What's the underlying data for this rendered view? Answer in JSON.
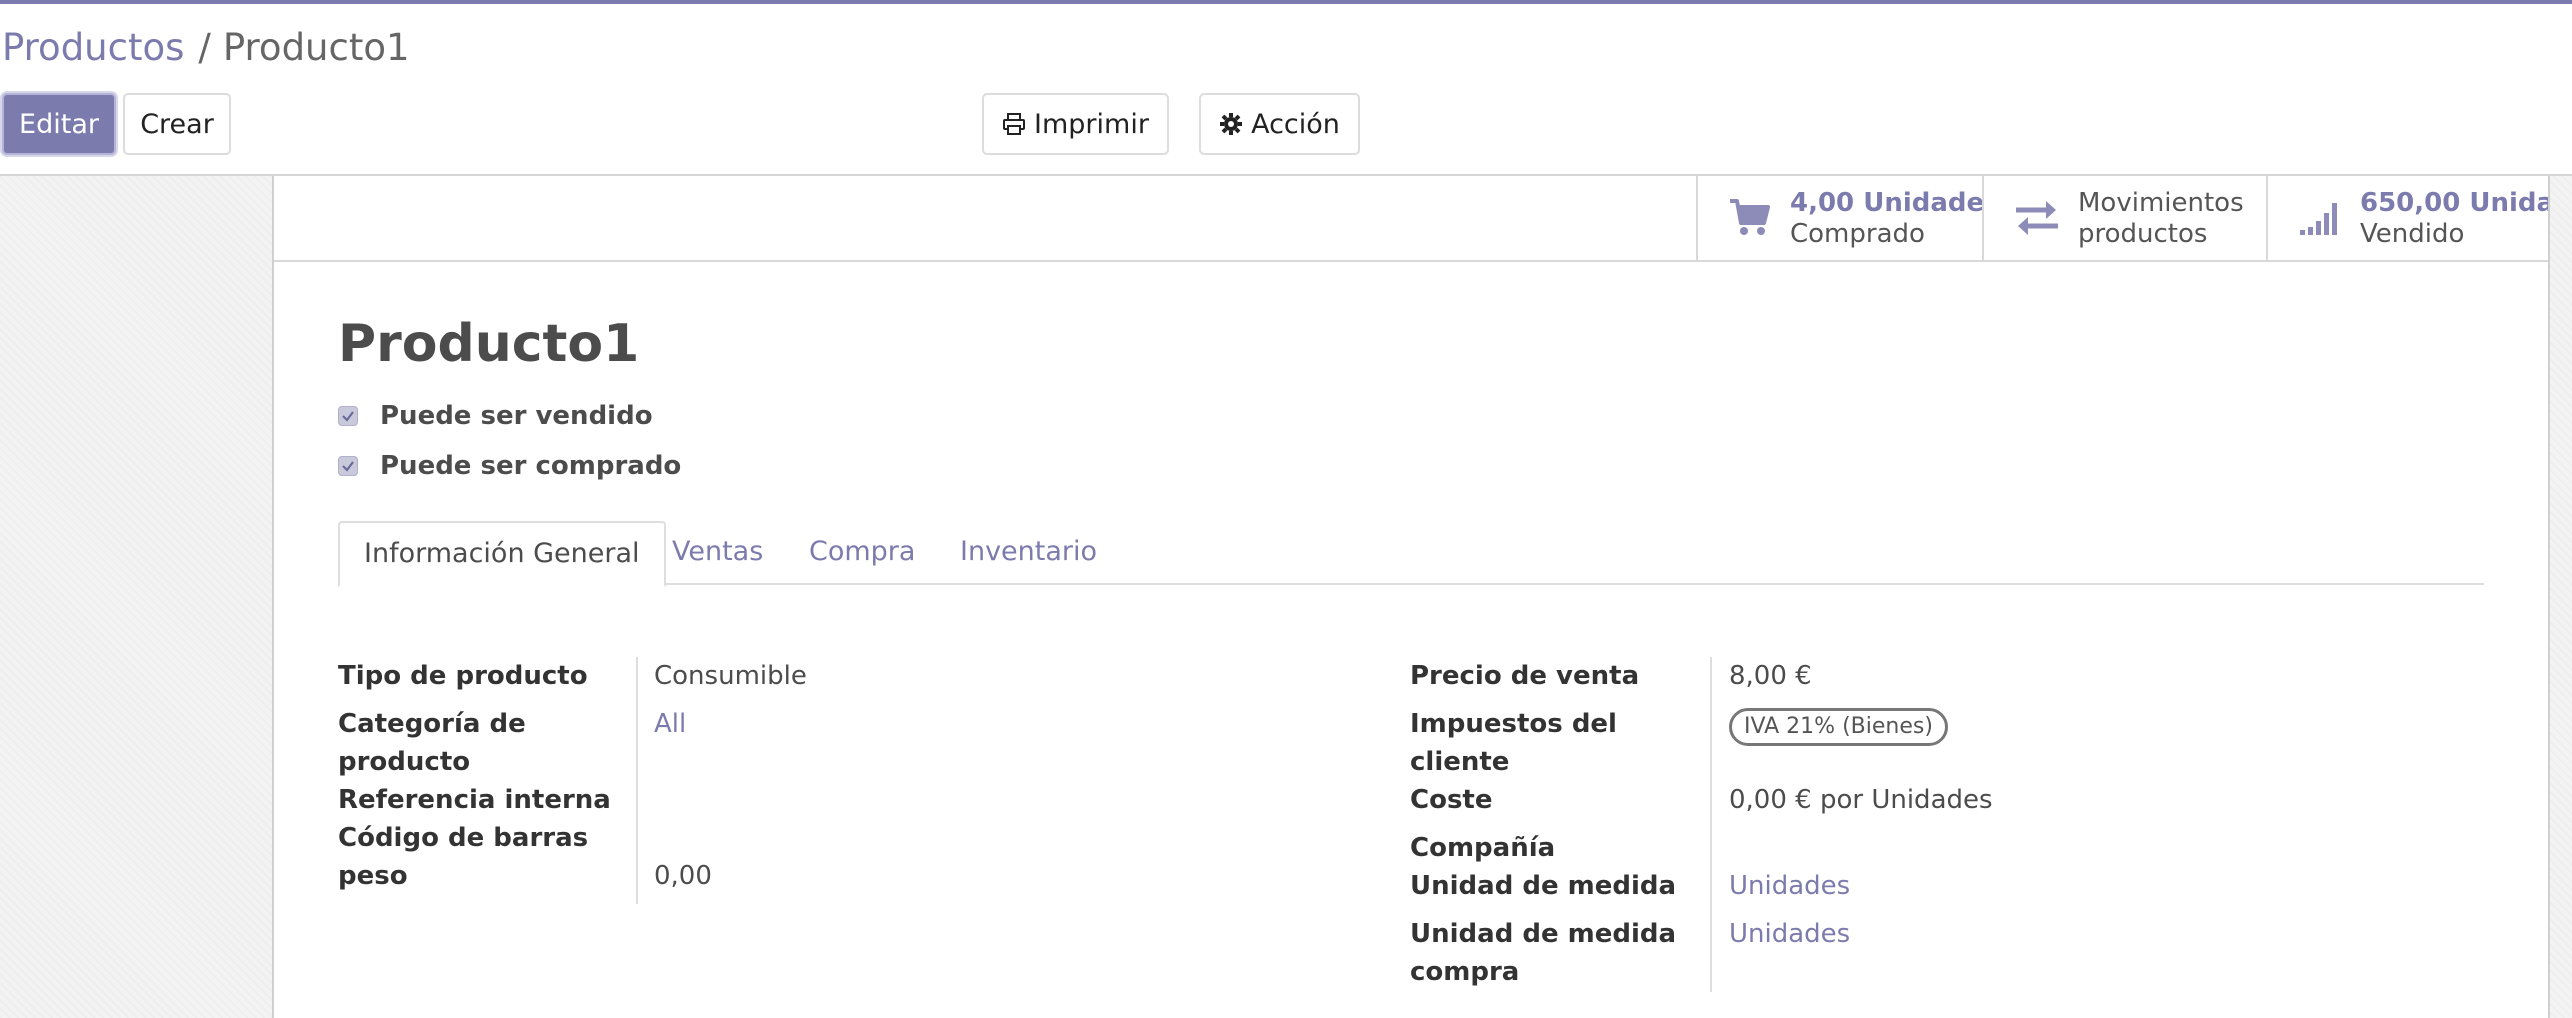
{
  "breadcrumb": {
    "parent": "Productos",
    "separator": "/",
    "current": "Producto1"
  },
  "buttons": {
    "edit": "Editar",
    "create": "Crear",
    "print": "Imprimir",
    "action": "Acción"
  },
  "smart_buttons": [
    {
      "value": "4,00 Unidade",
      "label": "Comprado",
      "icon": "cart-icon"
    },
    {
      "value": "Movimientos",
      "label": "productos",
      "icon": "transfer-arrows-icon"
    },
    {
      "value": "650,00 Unida",
      "label": "Vendido",
      "icon": "signal-bars-icon"
    }
  ],
  "product": {
    "name": "Producto1",
    "can_be_sold": "Puede ser vendido",
    "can_be_purchased": "Puede ser comprado"
  },
  "tabs": [
    "Información General",
    "Ventas",
    "Compra",
    "Inventario"
  ],
  "left_fields": {
    "type_label": "Tipo de producto",
    "type_value": "Consumible",
    "category_label_1": "Categoría de",
    "category_label_2": "producto",
    "category_value": "All",
    "internal_ref_label": "Referencia interna",
    "barcode_label": "Código de barras",
    "weight_label": "peso",
    "weight_value": "0,00"
  },
  "right_fields": {
    "price_label": "Precio de venta",
    "price_value": "8,00 €",
    "taxes_label_1": "Impuestos del",
    "taxes_label_2": "cliente",
    "taxes_tag": "IVA 21% (Bienes)",
    "cost_label": "Coste",
    "cost_value": "0,00 € por Unidades",
    "company_label": "Compañía",
    "uom_label": "Unidad de medida",
    "uom_value": "Unidades",
    "uom_po_label_1": "Unidad de medida",
    "uom_po_label_2": "compra",
    "uom_po_value": "Unidades"
  },
  "colors": {
    "accent": "#7c7bad",
    "text": "#4c4c4c"
  }
}
